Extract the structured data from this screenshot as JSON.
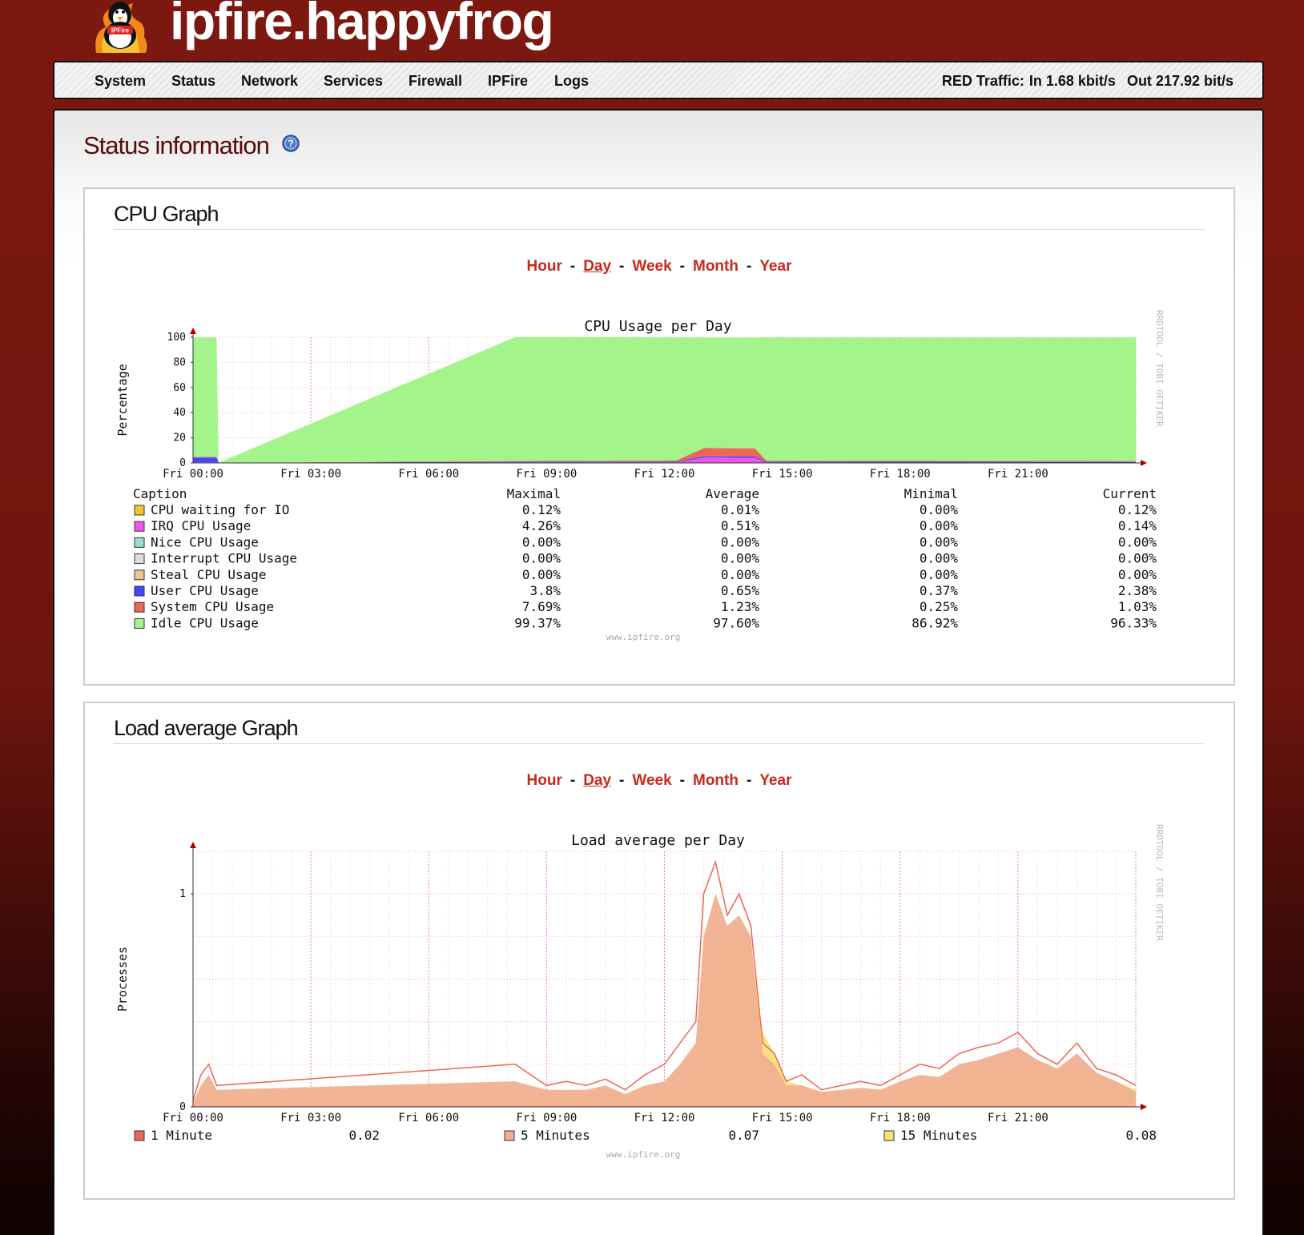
{
  "header": {
    "title": "ipfire.happyfrog",
    "logo_icon": "ipfire-penguin-logo",
    "logo_text": "IPFire"
  },
  "nav": {
    "items": [
      "System",
      "Status",
      "Network",
      "Services",
      "Firewall",
      "IPFire",
      "Logs"
    ],
    "traffic_label": "RED Traffic:",
    "traffic_in": "In 1.68 kbit/s",
    "traffic_out": "Out 217.92 bit/s"
  },
  "page": {
    "title": "Status information",
    "help_icon": "help-icon"
  },
  "sections": [
    {
      "title": "CPU Graph",
      "ranges": [
        "Hour",
        "Day",
        "Week",
        "Month",
        "Year"
      ],
      "active_range": "Day"
    },
    {
      "title": "Load average Graph",
      "ranges": [
        "Hour",
        "Day",
        "Week",
        "Month",
        "Year"
      ],
      "active_range": "Day"
    }
  ],
  "chart_data": [
    {
      "type": "area",
      "title": "CPU Usage per Day",
      "ylabel": "Percentage",
      "xlabel": "",
      "watermark": "RRDTOOL / TOBI OETIKER",
      "footer": "www.ipfire.org",
      "ylim": [
        0,
        100
      ],
      "yticks": [
        "0",
        "20",
        "40",
        "60",
        "80",
        "100"
      ],
      "xticks": [
        "Fri 00:00",
        "Fri 03:00",
        "Fri 06:00",
        "Fri 09:00",
        "Fri 12:00",
        "Fri 15:00",
        "Fri 18:00",
        "Fri 21:00"
      ],
      "x_hours": [
        0,
        0.6,
        0.65,
        8.2,
        12.3,
        13.0,
        14.3,
        14.6,
        24
      ],
      "series": [
        {
          "name": "CPU waiting for IO",
          "color": "#f1c232",
          "values": [
            0,
            0,
            0.1,
            0.1,
            0.1,
            0.1,
            0.1,
            0.1,
            0.1
          ]
        },
        {
          "name": "IRQ CPU Usage",
          "color": "#ee55ee",
          "values": [
            0.5,
            0.5,
            0,
            0.3,
            0.4,
            4.2,
            4.0,
            0.3,
            0.2
          ]
        },
        {
          "name": "Nice CPU Usage",
          "color": "#99ddcc",
          "values": [
            0,
            0,
            0,
            0,
            0,
            0,
            0,
            0,
            0
          ]
        },
        {
          "name": "Interrupt CPU Usage",
          "color": "#dddddd",
          "values": [
            0,
            0,
            0,
            0,
            0,
            0,
            0,
            0,
            0
          ]
        },
        {
          "name": "Steal CPU Usage",
          "color": "#f0c090",
          "values": [
            0,
            0,
            0,
            0,
            0,
            0,
            0,
            0,
            0
          ]
        },
        {
          "name": "User CPU Usage",
          "color": "#4444ff",
          "values": [
            3.8,
            3.8,
            0,
            0.5,
            0.6,
            1.0,
            1.0,
            0.6,
            0.5
          ]
        },
        {
          "name": "System CPU Usage",
          "color": "#ee6655",
          "values": [
            0.5,
            0.5,
            0,
            0.6,
            0.8,
            6.5,
            6.5,
            0.8,
            0.7
          ]
        },
        {
          "name": "Idle CPU Usage",
          "color": "#a4f48c",
          "values": [
            95,
            95,
            0,
            98.5,
            98,
            88,
            88,
            98,
            98.4
          ]
        }
      ],
      "legend": {
        "headers": [
          "Caption",
          "Maximal",
          "Average",
          "Minimal",
          "Current"
        ],
        "rows": [
          {
            "name": "CPU waiting for IO",
            "color": "#f1c232",
            "max": "0.12%",
            "avg": "0.01%",
            "min": "0.00%",
            "cur": "0.12%"
          },
          {
            "name": "IRQ CPU Usage",
            "color": "#ee55ee",
            "max": "4.26%",
            "avg": "0.51%",
            "min": "0.00%",
            "cur": "0.14%"
          },
          {
            "name": "Nice CPU Usage",
            "color": "#99ddcc",
            "max": "0.00%",
            "avg": "0.00%",
            "min": "0.00%",
            "cur": "0.00%"
          },
          {
            "name": "Interrupt CPU Usage",
            "color": "#dddddd",
            "max": "0.00%",
            "avg": "0.00%",
            "min": "0.00%",
            "cur": "0.00%"
          },
          {
            "name": "Steal CPU Usage",
            "color": "#f0c090",
            "max": "0.00%",
            "avg": "0.00%",
            "min": "0.00%",
            "cur": "0.00%"
          },
          {
            "name": "User CPU Usage",
            "color": "#4444ff",
            "max": "3.8%",
            "avg": "0.65%",
            "min": "0.37%",
            "cur": "2.38%"
          },
          {
            "name": "System CPU Usage",
            "color": "#ee6655",
            "max": "7.69%",
            "avg": "1.23%",
            "min": "0.25%",
            "cur": "1.03%"
          },
          {
            "name": "Idle CPU Usage",
            "color": "#a4f48c",
            "max": "99.37%",
            "avg": "97.60%",
            "min": "86.92%",
            "cur": "96.33%"
          }
        ]
      }
    },
    {
      "type": "area",
      "title": "Load average per Day",
      "ylabel": "Processes",
      "xlabel": "",
      "watermark": "RRDTOOL / TOBI OETIKER",
      "footer": "www.ipfire.org",
      "ylim": [
        0,
        1.2
      ],
      "yticks": [
        "0",
        "1"
      ],
      "xticks": [
        "Fri 00:00",
        "Fri 03:00",
        "Fri 06:00",
        "Fri 09:00",
        "Fri 12:00",
        "Fri 15:00",
        "Fri 18:00",
        "Fri 21:00"
      ],
      "x_hours": [
        0,
        0.2,
        0.4,
        0.6,
        8.2,
        8.6,
        9.0,
        9.5,
        10.0,
        10.5,
        11.0,
        11.5,
        12.0,
        12.4,
        12.8,
        13.0,
        13.3,
        13.6,
        13.9,
        14.2,
        14.5,
        14.8,
        15.1,
        15.5,
        16.0,
        16.5,
        17.0,
        17.5,
        18.0,
        18.5,
        19.0,
        19.5,
        20.0,
        20.5,
        21.0,
        21.5,
        22.0,
        22.5,
        23.0,
        23.5,
        24.0
      ],
      "series": [
        {
          "name": "1 Minute",
          "color": "#ee6655",
          "values": [
            0.03,
            0.15,
            0.2,
            0.1,
            0.2,
            0.15,
            0.1,
            0.12,
            0.1,
            0.13,
            0.08,
            0.15,
            0.2,
            0.3,
            0.4,
            1.0,
            1.15,
            0.9,
            1.0,
            0.85,
            0.3,
            0.25,
            0.12,
            0.15,
            0.08,
            0.1,
            0.12,
            0.1,
            0.15,
            0.2,
            0.18,
            0.25,
            0.28,
            0.3,
            0.35,
            0.25,
            0.2,
            0.3,
            0.18,
            0.15,
            0.1
          ]
        },
        {
          "name": "5 Minutes",
          "color": "#f0b090",
          "values": [
            0.02,
            0.1,
            0.15,
            0.08,
            0.12,
            0.1,
            0.08,
            0.08,
            0.08,
            0.1,
            0.06,
            0.1,
            0.12,
            0.2,
            0.3,
            0.8,
            1.0,
            0.85,
            0.9,
            0.8,
            0.25,
            0.2,
            0.1,
            0.1,
            0.07,
            0.08,
            0.09,
            0.08,
            0.12,
            0.15,
            0.14,
            0.2,
            0.22,
            0.25,
            0.28,
            0.22,
            0.18,
            0.25,
            0.16,
            0.12,
            0.07
          ]
        },
        {
          "name": "15 Minutes",
          "color": "#f5e07a",
          "values": [
            0.01,
            0.05,
            0.08,
            0.05,
            0.06,
            0.06,
            0.06,
            0.06,
            0.06,
            0.07,
            0.05,
            0.07,
            0.08,
            0.12,
            0.18,
            0.55,
            0.75,
            0.78,
            0.8,
            0.75,
            0.35,
            0.25,
            0.12,
            0.1,
            0.07,
            0.07,
            0.07,
            0.07,
            0.09,
            0.11,
            0.12,
            0.15,
            0.17,
            0.19,
            0.21,
            0.2,
            0.17,
            0.19,
            0.15,
            0.12,
            0.08
          ]
        }
      ],
      "legend": {
        "rows": [
          {
            "name": "1 Minute",
            "color": "#ee6655",
            "cur": "0.02"
          },
          {
            "name": "5 Minutes",
            "color": "#f0b090",
            "cur": "0.07"
          },
          {
            "name": "15 Minutes",
            "color": "#f5e07a",
            "cur": "0.08"
          }
        ]
      }
    }
  ]
}
